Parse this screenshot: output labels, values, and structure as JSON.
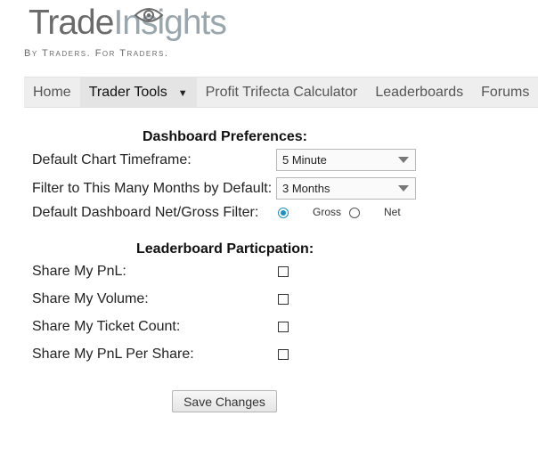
{
  "header": {
    "logo_part1": "Trade",
    "logo_part2": "Insights",
    "tagline": "By Traders. For Traders."
  },
  "nav": {
    "items": [
      {
        "label": "Home"
      },
      {
        "label": "Trader Tools",
        "has_dropdown": true
      },
      {
        "label": "Profit Trifecta Calculator"
      },
      {
        "label": "Leaderboards"
      },
      {
        "label": "Forums"
      }
    ]
  },
  "dashboard": {
    "title": "Dashboard Preferences:",
    "chart_timeframe_label": "Default Chart Timeframe:",
    "chart_timeframe_value": "5 Minute",
    "months_filter_label": "Filter to This Many Months by Default:",
    "months_filter_value": "3 Months",
    "net_gross_label": "Default Dashboard Net/Gross Filter:",
    "gross_label": "Gross",
    "net_label": "Net",
    "selected": "Gross"
  },
  "leaderboard": {
    "title": "Leaderboard Particpation:",
    "share_pnl_label": "Share My PnL:",
    "share_volume_label": "Share My Volume:",
    "share_ticket_label": "Share My Ticket Count:",
    "share_pnl_per_share_label": "Share My PnL Per Share:",
    "share_pnl_checked": false,
    "share_volume_checked": false,
    "share_ticket_checked": false,
    "share_pnl_per_share_checked": false
  },
  "save_button_label": "Save Changes",
  "colors": {
    "accent": "#1e8fc0",
    "nav_bg": "#eeeeee",
    "logo_dark": "#6b6b6b",
    "logo_light": "#9aa6ad"
  }
}
